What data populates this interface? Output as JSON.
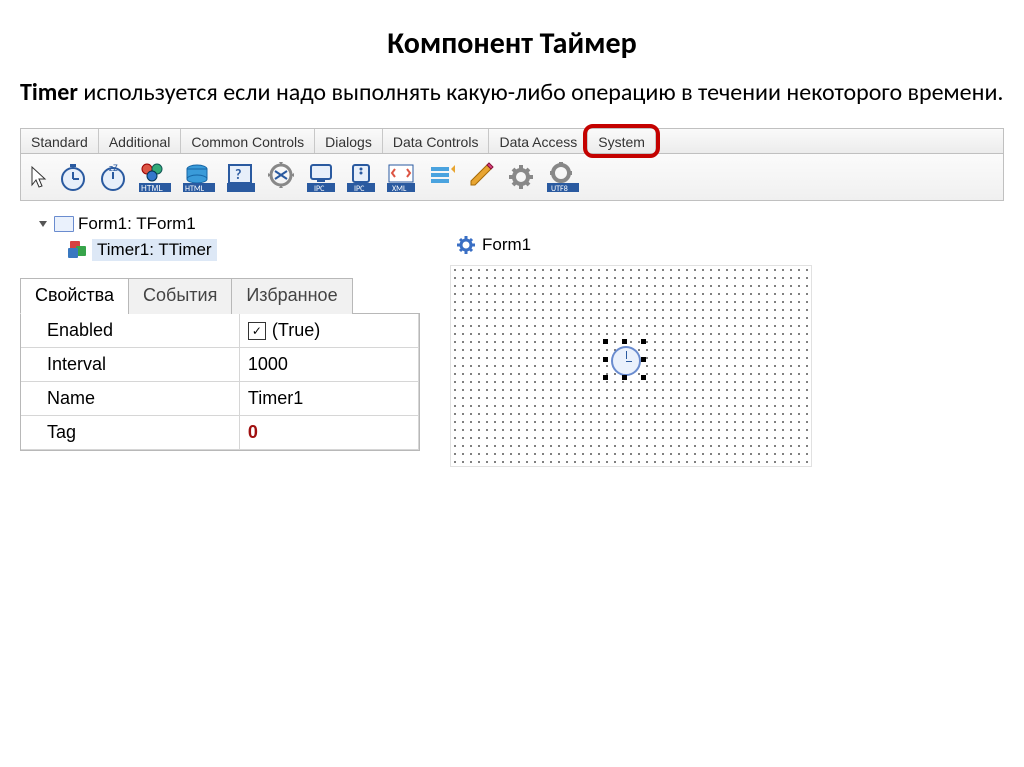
{
  "slide": {
    "title": "Компонент Таймер",
    "desc_bold": "Timer",
    "desc_rest": " используется если надо выполнять какую-либо операцию в течении некоторого времени."
  },
  "palette_tabs": [
    "Standard",
    "Additional",
    "Common Controls",
    "Dialogs",
    "Data Controls",
    "Data Access",
    "System"
  ],
  "tree": {
    "root": "Form1: TForm1",
    "child": "Timer1: TTimer"
  },
  "prop_tabs": {
    "a": "Свойства",
    "b": "События",
    "c": "Избранное"
  },
  "props": {
    "r0k": "Enabled",
    "r0v": "(True)",
    "r1k": "Interval",
    "r1v": "1000",
    "r2k": "Name",
    "r2v": "Timer1",
    "r3k": "Tag",
    "r3v": "0"
  },
  "designer": {
    "form_caption": "Form1"
  }
}
